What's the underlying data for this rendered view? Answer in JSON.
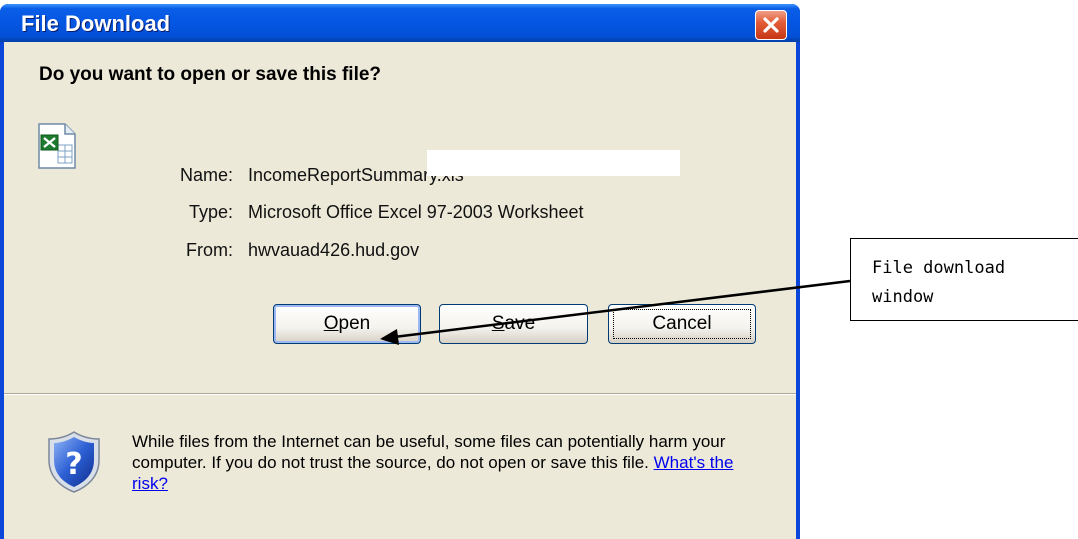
{
  "dialog": {
    "title": "File Download",
    "headline": "Do you want to open or save this file?",
    "file": {
      "name_label": "Name:",
      "name_value": "IncomeReportSummary.xls",
      "type_label": "Type:",
      "type_value": "Microsoft Office Excel 97-2003 Worksheet",
      "from_label": "From:",
      "from_value": "hwvauad426.hud.gov"
    },
    "buttons": {
      "open": {
        "accel": "O",
        "rest": "pen"
      },
      "save": {
        "accel": "S",
        "rest": "ave"
      },
      "cancel": "Cancel"
    },
    "warning": {
      "text": "While files from the Internet can be useful, some files can potentially harm your computer. If you do not trust the source, do not open or save this file. ",
      "link": "What's the risk?"
    }
  },
  "callout": {
    "text": "File download\nwindow"
  },
  "icons": {
    "file": "excel-file-icon",
    "warning": "security-shield-question-icon",
    "close": "close-icon"
  },
  "colors": {
    "titlebar": "#0456e3",
    "dialog_bg": "#ece9d8",
    "close_button": "#e35d39"
  }
}
